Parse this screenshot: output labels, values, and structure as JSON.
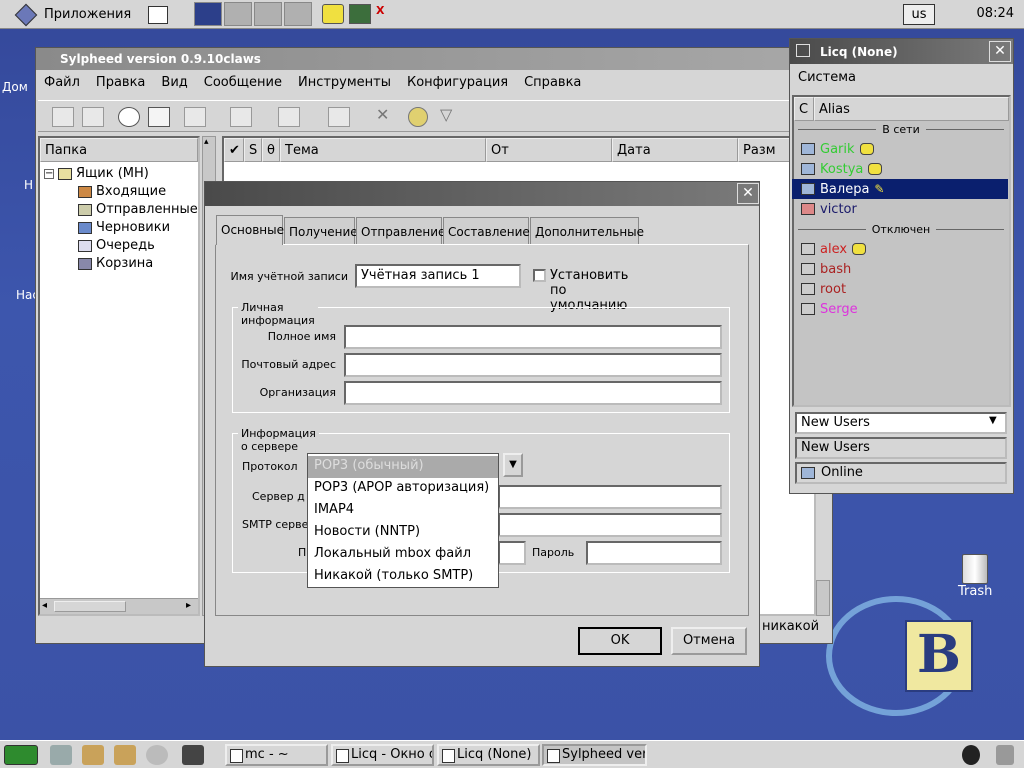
{
  "top_panel": {
    "apps_label": "Приложения",
    "keyboard_layout": "us",
    "clock": "08:24"
  },
  "desktop": {
    "icon_labels": [
      "Дом",
      "Н",
      "Нас"
    ],
    "trash_label": "Trash"
  },
  "sylpheed": {
    "title": "Sylpheed version 0.9.10claws",
    "menu": [
      "Файл",
      "Правка",
      "Вид",
      "Сообщение",
      "Инструменты",
      "Конфигурация",
      "Справка"
    ],
    "folder_header": "Папка",
    "folders": {
      "root": "Ящик (MH)",
      "items": [
        "Входящие",
        "Отправленные",
        "Черновики",
        "Очередь",
        "Корзина"
      ]
    },
    "columns": {
      "check": "✔",
      "status": "S",
      "attach": "θ",
      "subject": "Тема",
      "from": "От",
      "date": "Дата",
      "size": "Разм"
    },
    "status_account": "никакой"
  },
  "dialog": {
    "close": "✕",
    "tabs": [
      "Основные",
      "Получение",
      "Отправление",
      "Составление",
      "Дополнительные"
    ],
    "account_name_label": "Имя учётной записи",
    "account_name_value": "Учётная запись 1",
    "default_checkbox_label": "Установить по умолчанию",
    "personal_frame": "Личная информация",
    "full_name_label": "Полное имя",
    "email_label": "Почтовый адрес",
    "org_label": "Организация",
    "server_frame": "Информация о сервере",
    "protocol_label": "Протокол",
    "server_label": "Сервер д",
    "smtp_label": "SMTP серве",
    "user_label_partial": "П",
    "password_label": "Пароль",
    "ok": "OK",
    "cancel": "Отмена",
    "protocol_options": [
      "POP3 (обычный)",
      "POP3 (APOP авторизация)",
      "IMAP4",
      "Новости (NNTP)",
      "Локальный mbox файл",
      "Никакой (только SMTP)"
    ],
    "protocol_selected": "POP3 (обычный)"
  },
  "licq": {
    "title": "Licq (None)",
    "menu_system": "Система",
    "col_c": "C",
    "col_alias": "Alias",
    "group_online": "В сети",
    "group_offline": "Отключен",
    "online_users": [
      {
        "name": "Garik",
        "color": "#33cc33"
      },
      {
        "name": "Kostya",
        "color": "#33cc33"
      },
      {
        "name": "Валера",
        "color": "#ffffff"
      },
      {
        "name": "victor",
        "color": "#1a1a6a"
      }
    ],
    "offline_users": [
      {
        "name": "alex",
        "color": "#cc2222"
      },
      {
        "name": "bash",
        "color": "#aa2222"
      },
      {
        "name": "root",
        "color": "#aa2222"
      },
      {
        "name": "Serge",
        "color": "#dd33dd"
      }
    ],
    "group_select": "New Users",
    "group_label": "New Users",
    "status": "Online",
    "status_color": "#33cc33"
  },
  "taskbar": {
    "tasks": [
      "mc - ~",
      "Licq - Окно от",
      "Licq (None)",
      "Sylpheed vers"
    ]
  }
}
